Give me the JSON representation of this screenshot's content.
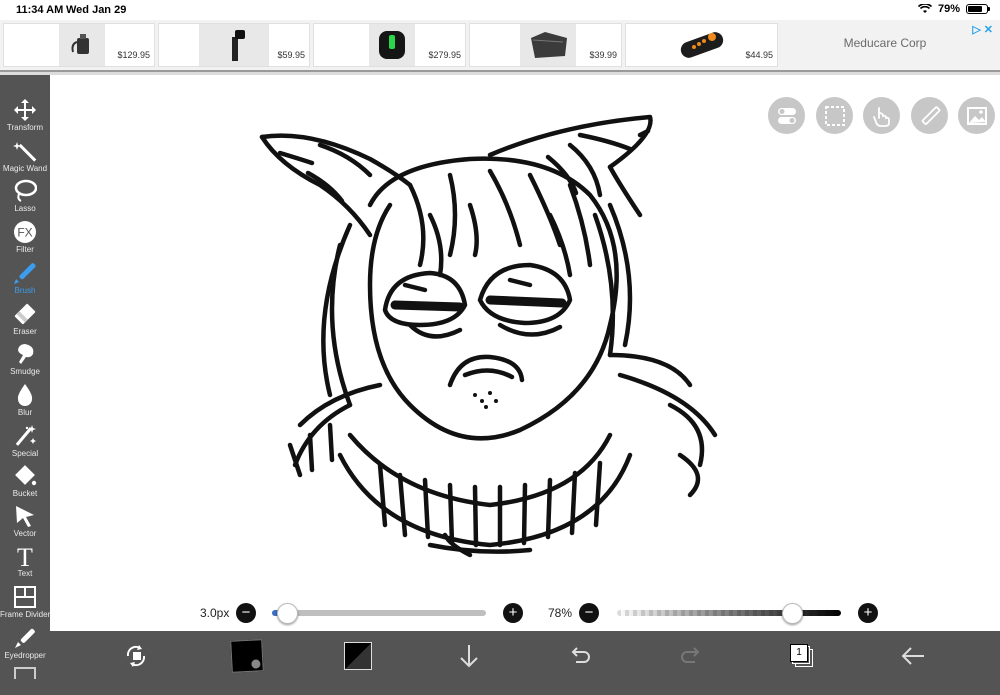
{
  "status": {
    "time": "11:34 AM",
    "date": "Wed Jan 29",
    "battery": "79%"
  },
  "ad": {
    "items": [
      {
        "price": "$129.95",
        "icon": "charger-product"
      },
      {
        "price": "$59.95",
        "icon": "gimbal-product"
      },
      {
        "price": "$279.95",
        "icon": "device-product"
      },
      {
        "price": "$39.99",
        "icon": "case-product"
      },
      {
        "price": "$44.95",
        "icon": "remote-product"
      }
    ],
    "brand": "Meducare Corp",
    "adchoices": "▷✕"
  },
  "tools": [
    {
      "label": "Transform",
      "icon": "move-icon"
    },
    {
      "label": "Magic Wand",
      "icon": "magic-wand-icon"
    },
    {
      "label": "Lasso",
      "icon": "lasso-icon"
    },
    {
      "label": "Filter",
      "icon": "fx-icon"
    },
    {
      "label": "Brush",
      "icon": "brush-icon",
      "active": true
    },
    {
      "label": "Eraser",
      "icon": "eraser-icon"
    },
    {
      "label": "Smudge",
      "icon": "smudge-icon"
    },
    {
      "label": "Blur",
      "icon": "blur-drop-icon"
    },
    {
      "label": "Special",
      "icon": "special-wand-icon"
    },
    {
      "label": "Bucket",
      "icon": "bucket-icon"
    },
    {
      "label": "Vector",
      "icon": "vector-arrow-icon"
    },
    {
      "label": "Text",
      "icon": "text-icon"
    },
    {
      "label": "Frame Divider",
      "icon": "frame-divider-icon"
    },
    {
      "label": "Eyedropper",
      "icon": "eyedropper-icon"
    }
  ],
  "canvas_buttons": [
    "toggle-icon",
    "selection-icon",
    "finger-icon",
    "ruler-pencil-icon",
    "image-icon"
  ],
  "brush": {
    "size": "3.0px",
    "size_fraction": 0.07,
    "opacity": "78%",
    "opacity_fraction": 0.78
  },
  "bottom": {
    "layers_count": "1"
  },
  "colors": {
    "toolbar": "#545454",
    "accent": "#3b9df0"
  }
}
